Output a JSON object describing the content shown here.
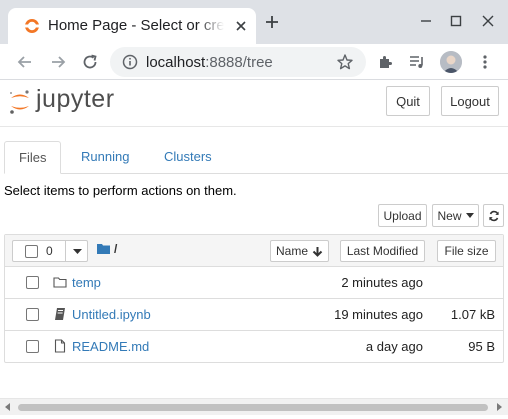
{
  "browser": {
    "tab_title": "Home Page - Select or create a notebook",
    "url_host": "localhost",
    "url_rest": ":8888/tree",
    "accent": "#f37726"
  },
  "header": {
    "logo_text": "jupyter",
    "quit_label": "Quit",
    "logout_label": "Logout"
  },
  "tabs": [
    {
      "label": "Files"
    },
    {
      "label": "Running"
    },
    {
      "label": "Clusters"
    }
  ],
  "hint": "Select items to perform actions on them.",
  "toolbar": {
    "upload_label": "Upload",
    "new_label": "New",
    "refresh_icon": "refresh-icon"
  },
  "list_header": {
    "selected_count": "0",
    "breadcrumb": "/",
    "sort_name": "Name",
    "sort_modified": "Last Modified",
    "sort_size": "File size"
  },
  "rows": [
    {
      "name": "temp",
      "type": "folder",
      "modified": "2 minutes ago",
      "size": ""
    },
    {
      "name": "Untitled.ipynb",
      "type": "notebook",
      "modified": "19 minutes ago",
      "size": "1.07 kB"
    },
    {
      "name": "README.md",
      "type": "file",
      "modified": "a day ago",
      "size": "95 B"
    }
  ]
}
